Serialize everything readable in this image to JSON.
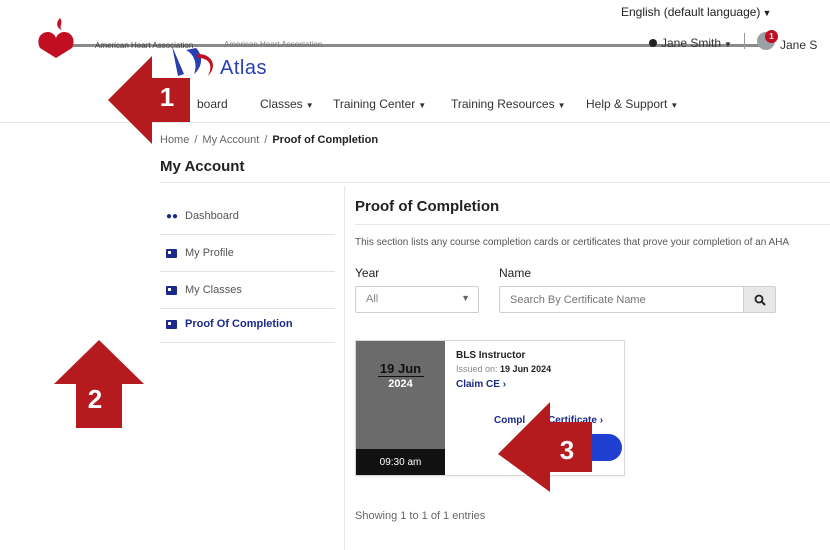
{
  "language": {
    "label": "English (default language)"
  },
  "header": {
    "org_name": "American Heart Association",
    "org_name_overlay": "American Heart Association",
    "user_name": "Jane Smith",
    "user_name_overlay": "Jane S",
    "notification_count": "1",
    "app_name": "Atlas"
  },
  "nav": {
    "items": [
      {
        "label": "Dashboard",
        "visible_text": "board"
      },
      {
        "label": "Classes"
      },
      {
        "label": "Training Center"
      },
      {
        "label": "Training Resources"
      },
      {
        "label": "Help & Support"
      }
    ]
  },
  "breadcrumb": {
    "home": "Home",
    "account": "My Account",
    "current": "Proof of Completion"
  },
  "page_title": "My Account",
  "sidebar": {
    "items": [
      {
        "label": "Dashboard",
        "icon": "people-icon"
      },
      {
        "label": "My Profile",
        "icon": "id-card-icon"
      },
      {
        "label": "My Classes",
        "icon": "id-card-icon"
      },
      {
        "label": "Proof Of Completion",
        "icon": "id-card-icon",
        "active": true
      }
    ]
  },
  "main": {
    "title": "Proof of Completion",
    "description": "This section lists any course completion cards or certificates that prove your completion of an AHA",
    "filters": {
      "year_label": "Year",
      "year_value": "All",
      "name_label": "Name",
      "name_placeholder": "Search By Certificate Name"
    },
    "certificate": {
      "day": "19 Jun",
      "year": "2024",
      "time": "09:30 am",
      "name": "BLS Instructor",
      "issued_label": "Issued on:",
      "issued_date": "19 Jun 2024",
      "claim_ce": "Claim CE",
      "completion_link": "Completion Certificate",
      "completion_link_visible": "Compl",
      "completion_link_tail": "n Certificate"
    },
    "entries": "Showing 1 to 1 of 1 entries"
  },
  "annotations": {
    "badges": [
      "1",
      "2",
      "3"
    ],
    "color": "#b51a1e"
  },
  "colors": {
    "brand_red": "#c10e21",
    "navy": "#1b2a8a",
    "button_blue": "#1e3fd0"
  }
}
